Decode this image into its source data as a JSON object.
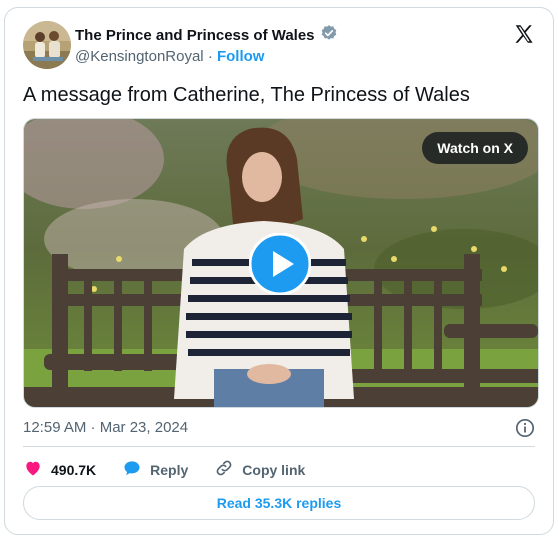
{
  "author": {
    "display_name": "The Prince and Princess of Wales",
    "handle": "@KensingtonRoyal",
    "separator": "·",
    "follow_label": "Follow",
    "verified_color": "#829aab"
  },
  "brand_icon": "x-logo-icon",
  "tweet": {
    "text": "A message from Catherine, The Princess of Wales"
  },
  "media": {
    "watch_label": "Watch on X",
    "play_icon": "play-icon",
    "accent": "#1d9bf0"
  },
  "meta": {
    "timestamp": "12:59 AM · Mar 23, 2024",
    "info_icon": "info-icon"
  },
  "actions": {
    "likes": "490.7K",
    "like_color": "#f91880",
    "reply_label": "Reply",
    "copy_link_label": "Copy link"
  },
  "footer": {
    "read_replies_label": "Read 35.3K replies"
  }
}
